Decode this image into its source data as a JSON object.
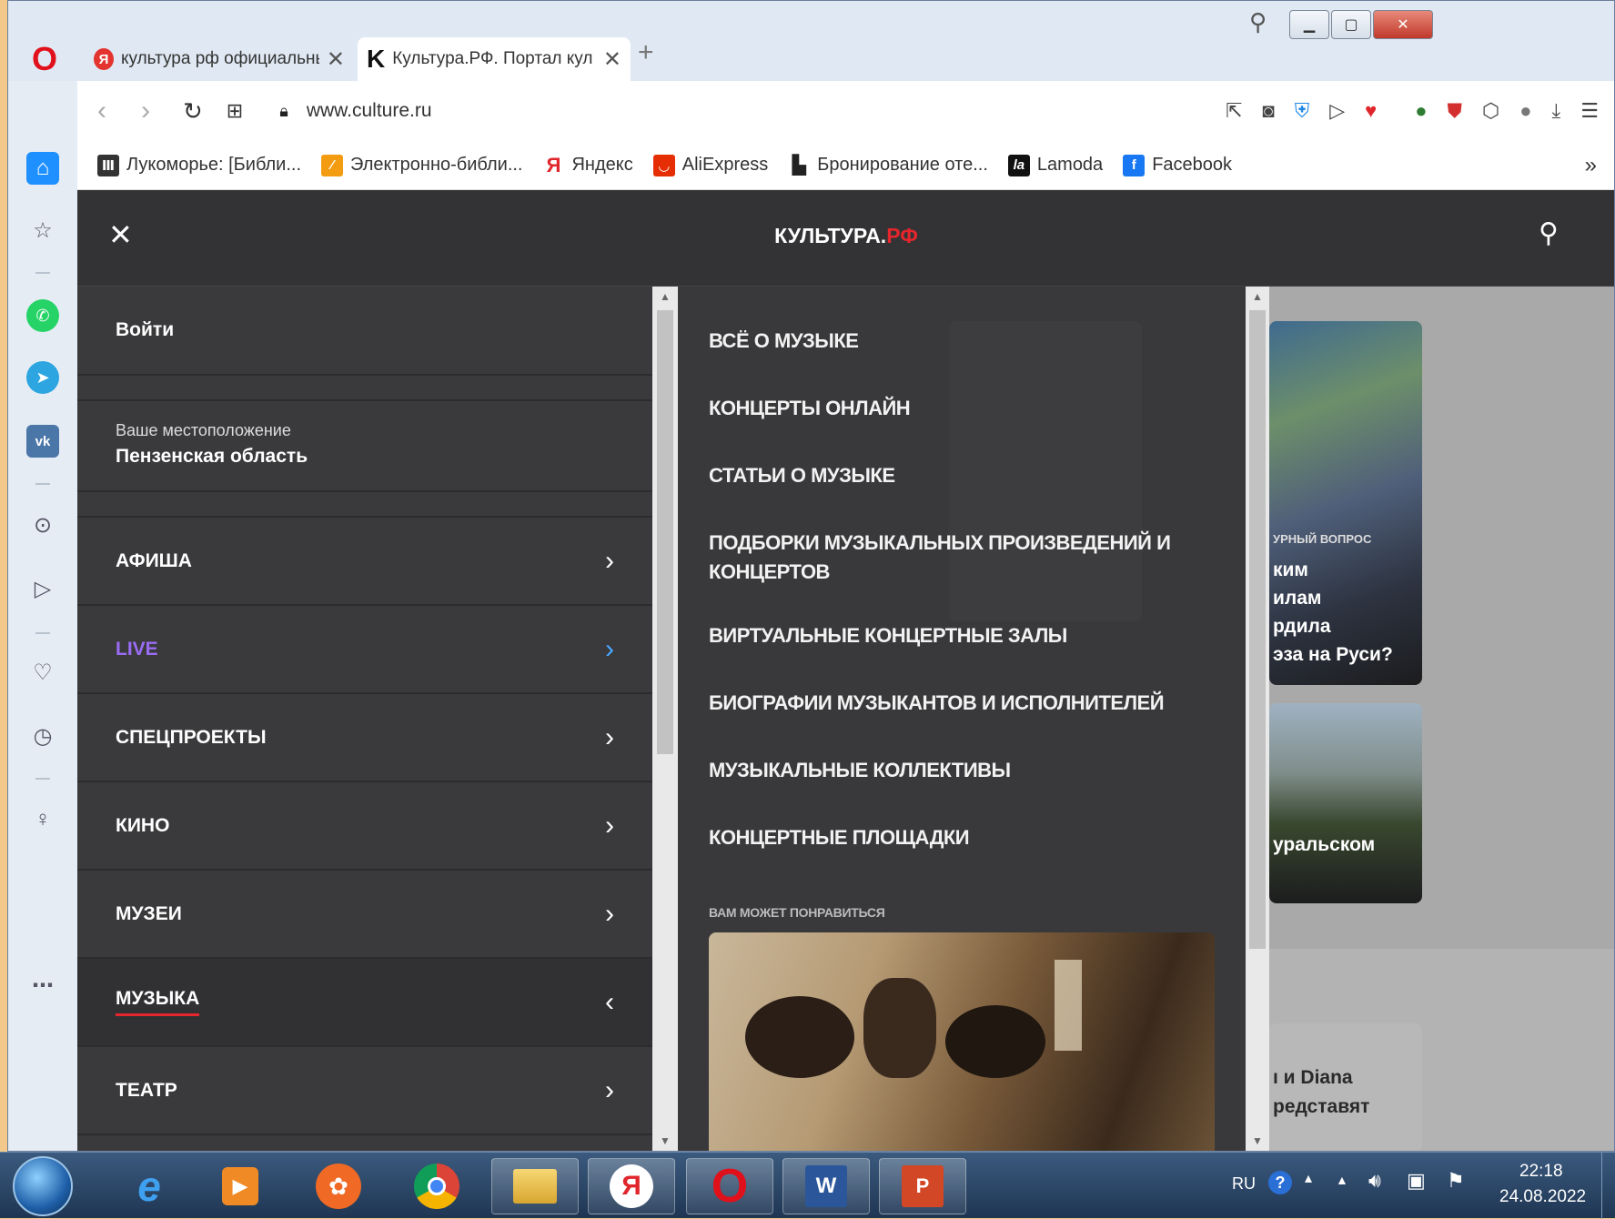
{
  "browser": {
    "tabs": [
      {
        "label": "культура рф официальный",
        "icon": "yandex-icon"
      },
      {
        "label": "Культура.РФ. Портал культ",
        "icon": "k-icon"
      }
    ],
    "new_tab": "+",
    "address": "www.culture.ru",
    "bookmarks": [
      {
        "label": "Лукоморье: [Библи...",
        "icon": "book-icon"
      },
      {
        "label": "Электронно-библи...",
        "icon": "elibrary-icon"
      },
      {
        "label": "Яндекс",
        "icon": "yandex-icon"
      },
      {
        "label": "AliExpress",
        "icon": "aliexpress-icon"
      },
      {
        "label": "Бронирование оте...",
        "icon": "page-icon"
      },
      {
        "label": "Lamoda",
        "icon": "lamoda-icon"
      },
      {
        "label": "Facebook",
        "icon": "facebook-icon"
      }
    ],
    "bookmarks_more": "»"
  },
  "site": {
    "logo_main": "КУЛЬТУРА.",
    "logo_accent": "РФ",
    "login": "Войти",
    "location_label": "Ваше местоположение",
    "location_value": "Пензенская область",
    "menu": [
      {
        "label": "АФИША",
        "color": "#ffffff",
        "chev": "›"
      },
      {
        "label": "LIVE",
        "color": "#9a6cf5",
        "chev": "›"
      },
      {
        "label": "СПЕЦПРОЕКТЫ",
        "color": "#ffffff",
        "chev": "›"
      },
      {
        "label": "КИНО",
        "color": "#ffffff",
        "chev": "›"
      },
      {
        "label": "МУЗЕИ",
        "color": "#ffffff",
        "chev": "›"
      },
      {
        "label": "МУЗЫКА",
        "color": "#ffffff",
        "chev": "‹"
      },
      {
        "label": "ТЕАТР",
        "color": "#ffffff",
        "chev": "›"
      }
    ],
    "submenu": [
      "ВСЁ О МУЗЫКЕ",
      "КОНЦЕРТЫ ОНЛАЙН",
      "СТАТЬИ О МУЗЫКЕ",
      "ПОДБОРКИ МУЗЫКАЛЬНЫХ ПРОИЗВЕДЕНИЙ И КОНЦЕРТОВ",
      "ВИРТУАЛЬНЫЕ КОНЦЕРТНЫЕ ЗАЛЫ",
      "БИОГРАФИИ МУЗЫКАНТОВ И ИСПОЛНИТЕЛЕЙ",
      "МУЗЫКАЛЬНЫЕ КОЛЛЕКТИВЫ",
      "КОНЦЕРТНЫЕ ПЛОЩАДКИ"
    ],
    "recommend_title": "ВАМ МОЖЕТ ПОНРАВИТЬСЯ",
    "bg_card1_tag": "УРНЫЙ ВОПРОС",
    "bg_card1_lines": [
      "ким",
      "илам",
      "рдила",
      "эза на Руси?"
    ],
    "bg_card2_text": "уральском",
    "bg_card3_lines": [
      "ı и Diana",
      "редставят"
    ]
  },
  "taskbar": {
    "lang": "RU",
    "time": "22:18",
    "date": "24.08.2022"
  },
  "colors": {
    "accent": "#e5262c",
    "live": "#9a6cf5",
    "active_underline": "#e5262c"
  }
}
